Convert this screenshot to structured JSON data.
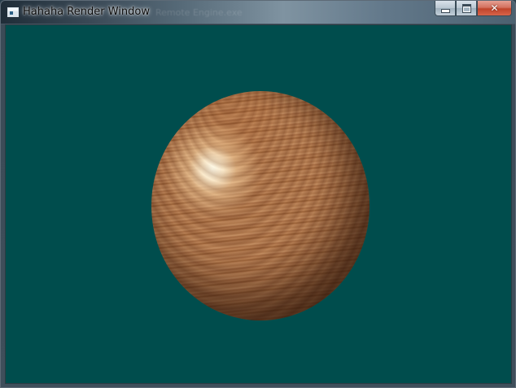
{
  "window": {
    "title": "Hahaha Render Window",
    "ghost_title": "Remote Engine.exe",
    "icon": "app-window-icon",
    "controls": {
      "minimize_icon": "minimize-icon",
      "maximize_icon": "maximize-icon",
      "close_icon": "close-icon",
      "close_glyph": "✕"
    }
  },
  "viewport": {
    "background_color": "#004d4d",
    "object": "wood-textured sphere"
  }
}
